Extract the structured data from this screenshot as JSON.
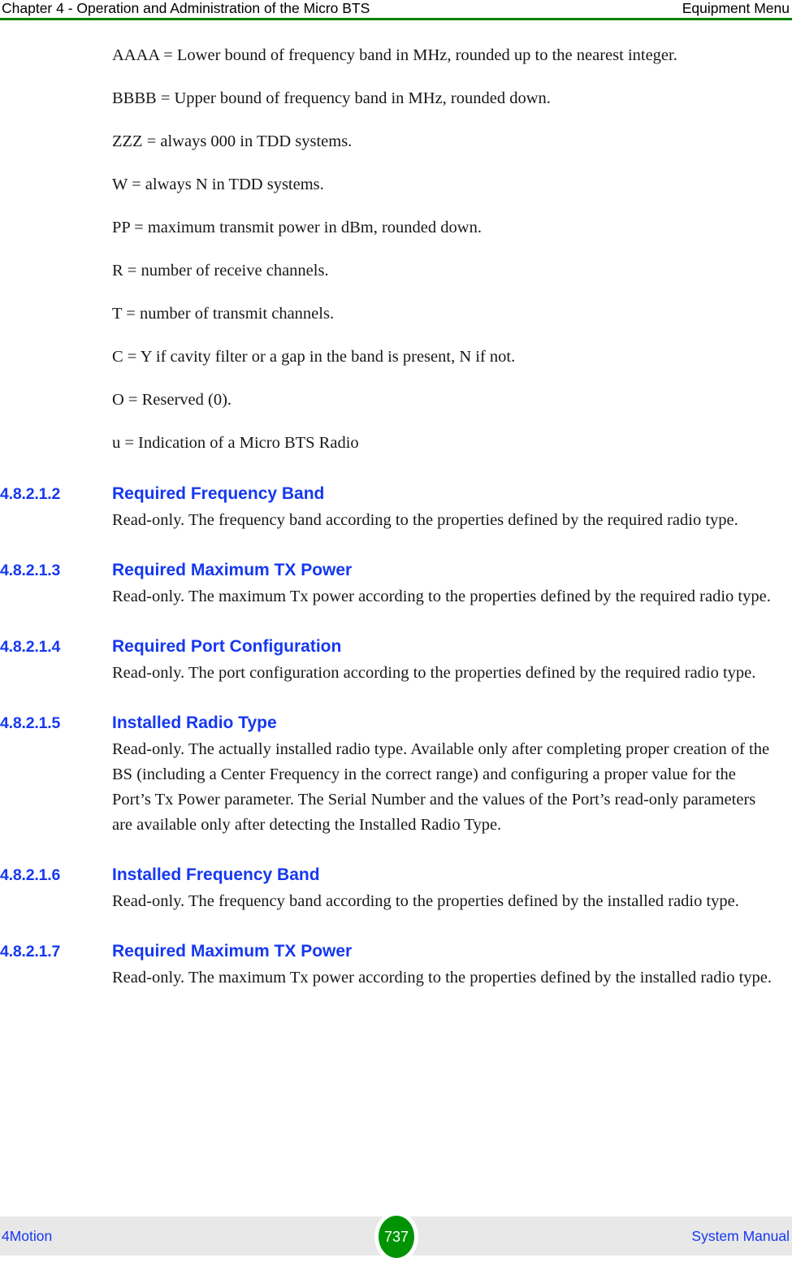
{
  "header": {
    "left": "Chapter 4 - Operation and Administration of the Micro BTS",
    "right": "Equipment Menu",
    "rule_color": "#008000"
  },
  "legend_paragraphs": [
    "AAAA = Lower bound of frequency band in MHz, rounded up to the nearest integer.",
    "BBBB = Upper bound of frequency band in MHz, rounded down.",
    "ZZZ = always 000 in TDD systems.",
    "W = always N in TDD systems.",
    "PP = maximum transmit power in dBm, rounded down.",
    "R = number of receive channels.",
    "T = number of transmit channels.",
    "C = Y if cavity filter or a gap in the band is present, N if not.",
    "O = Reserved (0).",
    "u = Indication of a Micro BTS Radio"
  ],
  "sections": [
    {
      "number": "4.8.2.1.2",
      "title": "Required Frequency Band",
      "body": "Read-only. The frequency band according to the properties defined by the required radio type."
    },
    {
      "number": "4.8.2.1.3",
      "title": "Required Maximum TX Power",
      "body": "Read-only. The maximum Tx power according to the properties defined by the required radio type."
    },
    {
      "number": "4.8.2.1.4",
      "title": "Required Port Configuration",
      "body": "Read-only. The port configuration according to the properties defined by the required radio type."
    },
    {
      "number": "4.8.2.1.5",
      "title": "Installed Radio Type",
      "body": "Read-only. The actually installed radio type. Available only after completing proper creation of the BS (including a Center Frequency in the correct range) and configuring a proper value for the Port’s Tx Power parameter. The Serial Number and the values of the Port’s read-only parameters are available only after detecting the Installed Radio Type."
    },
    {
      "number": "4.8.2.1.6",
      "title": "Installed Frequency Band",
      "body": "Read-only. The frequency band according to the properties defined by the installed radio type."
    },
    {
      "number": "4.8.2.1.7",
      "title": "Required Maximum TX Power",
      "body": "Read-only. The maximum Tx power according to the properties defined by the installed radio type."
    }
  ],
  "footer": {
    "left": "4Motion",
    "page_number": "737",
    "right": "System Manual",
    "badge_color": "#009404",
    "background_color": "#e8e8e8",
    "link_color": "#1538ef"
  }
}
